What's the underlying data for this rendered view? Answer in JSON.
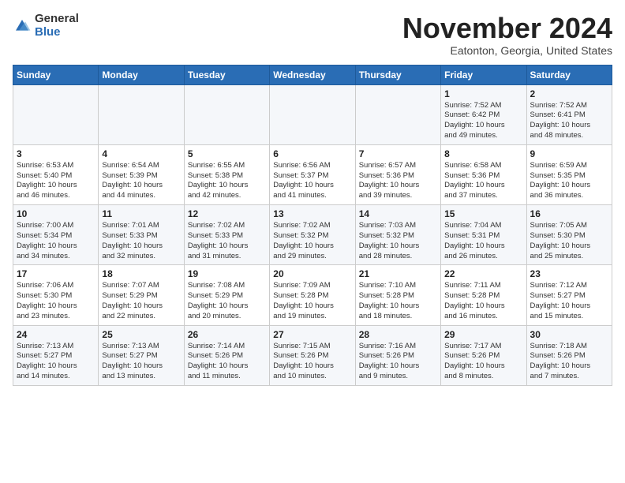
{
  "logo": {
    "general": "General",
    "blue": "Blue"
  },
  "title": "November 2024",
  "subtitle": "Eatonton, Georgia, United States",
  "weekdays": [
    "Sunday",
    "Monday",
    "Tuesday",
    "Wednesday",
    "Thursday",
    "Friday",
    "Saturday"
  ],
  "weeks": [
    [
      {
        "day": "",
        "info": ""
      },
      {
        "day": "",
        "info": ""
      },
      {
        "day": "",
        "info": ""
      },
      {
        "day": "",
        "info": ""
      },
      {
        "day": "",
        "info": ""
      },
      {
        "day": "1",
        "info": "Sunrise: 7:52 AM\nSunset: 6:42 PM\nDaylight: 10 hours\nand 49 minutes."
      },
      {
        "day": "2",
        "info": "Sunrise: 7:52 AM\nSunset: 6:41 PM\nDaylight: 10 hours\nand 48 minutes."
      }
    ],
    [
      {
        "day": "3",
        "info": "Sunrise: 6:53 AM\nSunset: 5:40 PM\nDaylight: 10 hours\nand 46 minutes."
      },
      {
        "day": "4",
        "info": "Sunrise: 6:54 AM\nSunset: 5:39 PM\nDaylight: 10 hours\nand 44 minutes."
      },
      {
        "day": "5",
        "info": "Sunrise: 6:55 AM\nSunset: 5:38 PM\nDaylight: 10 hours\nand 42 minutes."
      },
      {
        "day": "6",
        "info": "Sunrise: 6:56 AM\nSunset: 5:37 PM\nDaylight: 10 hours\nand 41 minutes."
      },
      {
        "day": "7",
        "info": "Sunrise: 6:57 AM\nSunset: 5:36 PM\nDaylight: 10 hours\nand 39 minutes."
      },
      {
        "day": "8",
        "info": "Sunrise: 6:58 AM\nSunset: 5:36 PM\nDaylight: 10 hours\nand 37 minutes."
      },
      {
        "day": "9",
        "info": "Sunrise: 6:59 AM\nSunset: 5:35 PM\nDaylight: 10 hours\nand 36 minutes."
      }
    ],
    [
      {
        "day": "10",
        "info": "Sunrise: 7:00 AM\nSunset: 5:34 PM\nDaylight: 10 hours\nand 34 minutes."
      },
      {
        "day": "11",
        "info": "Sunrise: 7:01 AM\nSunset: 5:33 PM\nDaylight: 10 hours\nand 32 minutes."
      },
      {
        "day": "12",
        "info": "Sunrise: 7:02 AM\nSunset: 5:33 PM\nDaylight: 10 hours\nand 31 minutes."
      },
      {
        "day": "13",
        "info": "Sunrise: 7:02 AM\nSunset: 5:32 PM\nDaylight: 10 hours\nand 29 minutes."
      },
      {
        "day": "14",
        "info": "Sunrise: 7:03 AM\nSunset: 5:32 PM\nDaylight: 10 hours\nand 28 minutes."
      },
      {
        "day": "15",
        "info": "Sunrise: 7:04 AM\nSunset: 5:31 PM\nDaylight: 10 hours\nand 26 minutes."
      },
      {
        "day": "16",
        "info": "Sunrise: 7:05 AM\nSunset: 5:30 PM\nDaylight: 10 hours\nand 25 minutes."
      }
    ],
    [
      {
        "day": "17",
        "info": "Sunrise: 7:06 AM\nSunset: 5:30 PM\nDaylight: 10 hours\nand 23 minutes."
      },
      {
        "day": "18",
        "info": "Sunrise: 7:07 AM\nSunset: 5:29 PM\nDaylight: 10 hours\nand 22 minutes."
      },
      {
        "day": "19",
        "info": "Sunrise: 7:08 AM\nSunset: 5:29 PM\nDaylight: 10 hours\nand 20 minutes."
      },
      {
        "day": "20",
        "info": "Sunrise: 7:09 AM\nSunset: 5:28 PM\nDaylight: 10 hours\nand 19 minutes."
      },
      {
        "day": "21",
        "info": "Sunrise: 7:10 AM\nSunset: 5:28 PM\nDaylight: 10 hours\nand 18 minutes."
      },
      {
        "day": "22",
        "info": "Sunrise: 7:11 AM\nSunset: 5:28 PM\nDaylight: 10 hours\nand 16 minutes."
      },
      {
        "day": "23",
        "info": "Sunrise: 7:12 AM\nSunset: 5:27 PM\nDaylight: 10 hours\nand 15 minutes."
      }
    ],
    [
      {
        "day": "24",
        "info": "Sunrise: 7:13 AM\nSunset: 5:27 PM\nDaylight: 10 hours\nand 14 minutes."
      },
      {
        "day": "25",
        "info": "Sunrise: 7:13 AM\nSunset: 5:27 PM\nDaylight: 10 hours\nand 13 minutes."
      },
      {
        "day": "26",
        "info": "Sunrise: 7:14 AM\nSunset: 5:26 PM\nDaylight: 10 hours\nand 11 minutes."
      },
      {
        "day": "27",
        "info": "Sunrise: 7:15 AM\nSunset: 5:26 PM\nDaylight: 10 hours\nand 10 minutes."
      },
      {
        "day": "28",
        "info": "Sunrise: 7:16 AM\nSunset: 5:26 PM\nDaylight: 10 hours\nand 9 minutes."
      },
      {
        "day": "29",
        "info": "Sunrise: 7:17 AM\nSunset: 5:26 PM\nDaylight: 10 hours\nand 8 minutes."
      },
      {
        "day": "30",
        "info": "Sunrise: 7:18 AM\nSunset: 5:26 PM\nDaylight: 10 hours\nand 7 minutes."
      }
    ]
  ]
}
